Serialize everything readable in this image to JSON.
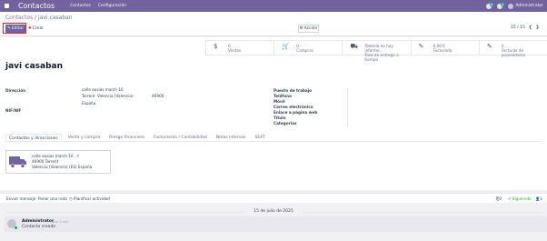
{
  "topbar": {
    "app_name": "Contactos",
    "menu": [
      "Contactos",
      "Configuración"
    ],
    "notif_chat": "5",
    "notif_activity": "2",
    "user": "Administrator"
  },
  "control": {
    "breadcrumb_parent": "Contactos",
    "breadcrumb_sep": " / ",
    "breadcrumb_current": "javi casaban",
    "edit_label": "Editar",
    "create_label": "Crear",
    "action_label": "Acción",
    "pager": "15 / 15",
    "edit_icon": "pencil-icon",
    "create_icon": "plus-icon",
    "action_icon": "gear-icon"
  },
  "stats": [
    {
      "icon": "dollar-icon",
      "value": "0",
      "label": "Ventas"
    },
    {
      "icon": "cart-icon",
      "value": "0",
      "label": "Compras"
    },
    {
      "icon": "truck-icon",
      "value": "Todavía no hay informe...",
      "label": "Tasa de entrega a tiempo"
    },
    {
      "icon": "pencil-icon",
      "value": "0,00 €",
      "label": "Facturado"
    },
    {
      "icon": "pencil-icon",
      "value": "0",
      "label": "Facturas de proveedores"
    }
  ],
  "partner": {
    "name": "javi casaban",
    "address_label": "Dirección",
    "street": "calle ausias march 16",
    "city_line_1": "Torrent",
    "city_line_2": "Valencia (Valencia)",
    "zip": "46900",
    "country": "España",
    "vat_label": "NIF/NIF",
    "right_labels": [
      "Puesto de trabajo",
      "Teléfono",
      "Móvil",
      "Correo electrónico",
      "Enlace a página web",
      "Título",
      "Categorías"
    ]
  },
  "tabs": [
    "Contactos y direcciones",
    "Venta y compra",
    "Riesgo financiero",
    "Facturación / Contabilidad",
    "Notas internas",
    "SEAT"
  ],
  "card": {
    "street": "calle ausias march 16",
    "zip_city": "46900 Torrent",
    "region": "Valencia (Valencia) (ES) España"
  },
  "chatter": {
    "send_message": "Enviar mensaje",
    "log_note": "Poner una nota",
    "schedule": "Planificar actividad",
    "attachments": "0",
    "follow": "Siguiendo",
    "followers": "1"
  },
  "thread": {
    "date": "15 de julio de 2025",
    "author": "Administrator",
    "time": "- hace 3 min",
    "body": "Contacto creado"
  }
}
